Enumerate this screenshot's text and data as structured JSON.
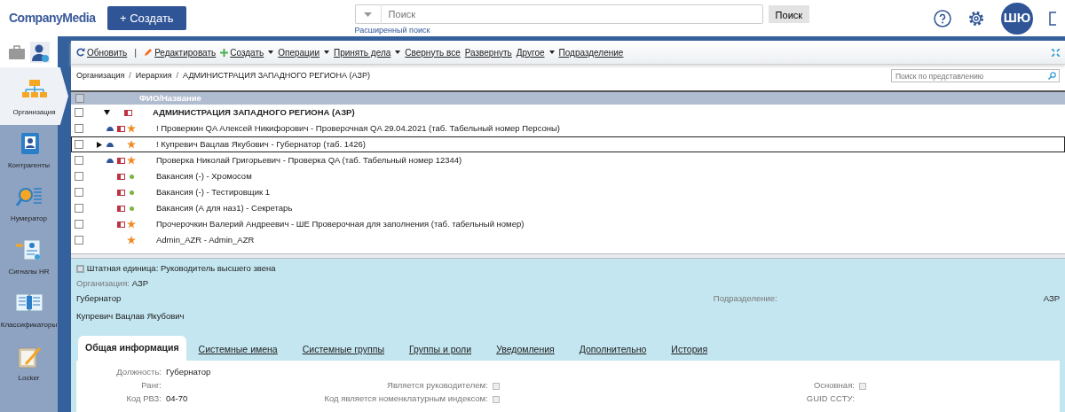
{
  "header": {
    "logo": "CompanyMedia",
    "create_button": "+ Создать",
    "search": {
      "placeholder": "Поиск",
      "button": "Поиск",
      "advanced_link": "Расширенный поиск"
    },
    "avatar": "ШЮ"
  },
  "sidebar": {
    "items": [
      {
        "label": "Организация",
        "selected": true
      },
      {
        "label": "Контрагенты",
        "selected": false
      },
      {
        "label": "Нумератор",
        "selected": false
      },
      {
        "label": "Сигналы HR",
        "selected": false
      },
      {
        "label": "Классификаторы",
        "selected": false
      },
      {
        "label": "Locker",
        "selected": false
      }
    ]
  },
  "toolbar": [
    {
      "kind": "button",
      "label": "Обновить",
      "menu": false
    },
    {
      "kind": "separator",
      "label": "|"
    },
    {
      "kind": "button",
      "label": "Редактировать",
      "menu": false
    },
    {
      "kind": "button",
      "label": "Создать",
      "menu": true
    },
    {
      "kind": "button",
      "label": "Операции",
      "menu": true
    },
    {
      "kind": "button",
      "label": "Принять дела",
      "menu": true
    },
    {
      "kind": "button",
      "label": "Свернуть все",
      "menu": false
    },
    {
      "kind": "button",
      "label": "Развернуть",
      "menu": false
    },
    {
      "kind": "button",
      "label": "Другое",
      "menu": true
    },
    {
      "kind": "button",
      "label": "Подразделение",
      "menu": false
    }
  ],
  "breadcrumb": [
    {
      "kind": "text",
      "label": "Организация"
    },
    {
      "kind": "separator",
      "label": "/"
    },
    {
      "kind": "link",
      "label": "Иерархия"
    },
    {
      "kind": "separator",
      "label": "/"
    },
    {
      "kind": "link",
      "label": "АДМИНИСТРАЦИЯ ЗАПАДНОГО РЕГИОНА (АЗР)"
    }
  ],
  "view_search": {
    "placeholder": "Поиск по представлению"
  },
  "table": {
    "select_all_checked": false,
    "columns": [
      "ФИО/Название"
    ],
    "rows": [
      {
        "kind": "unit",
        "text": "АДМИНИСТРАЦИЯ ЗАПАДНОГО РЕГИОНА (АЗР)",
        "expanded": true,
        "person": false,
        "card": true,
        "selected": false,
        "checked": false
      },
      {
        "kind": "employee",
        "text": "! Проверкин QA Алексей Никифорович - Проверочная QA 29.04.2021 (таб. Табельный номер Персоны)",
        "person": true,
        "card": true,
        "selected": false,
        "checked": false
      },
      {
        "kind": "employee",
        "text": "! Купревич Вацлав Якубович - Губернатор (таб. 1426)",
        "expanded": false,
        "person": true,
        "card": false,
        "selected": true,
        "checked": false
      },
      {
        "kind": "employee",
        "text": "Проверка Николай Григорьевич - Проверка QA (таб. Табельный номер 12344)",
        "person": true,
        "card": true,
        "selected": false,
        "checked": false
      },
      {
        "kind": "vacancy",
        "text": "Вакансия (-) - Хромосом",
        "person": false,
        "card": true,
        "selected": false,
        "checked": false
      },
      {
        "kind": "vacancy",
        "text": "Вакансия (-) - Тестировщик 1",
        "person": false,
        "card": true,
        "selected": false,
        "checked": false
      },
      {
        "kind": "vacancy",
        "text": "Вакансия (А для наз1) - Секретарь",
        "person": false,
        "card": true,
        "selected": false,
        "checked": false
      },
      {
        "kind": "employee",
        "text": "Прочерочкин Валерий Андреевич - ШЕ Проверочная для заполнения (таб. табельный номер)",
        "person": false,
        "card": true,
        "selected": false,
        "checked": false
      },
      {
        "kind": "employee",
        "text": "Admin_AZR - Admin_AZR",
        "person": false,
        "card": false,
        "selected": false,
        "checked": false
      }
    ]
  },
  "detail": {
    "title": "Штатная единица: Руководитель высшего звена",
    "org_label": "Организация:",
    "org_value": "АЗР",
    "position": "Губернатор",
    "person": "Купревич Вацлав Якубович",
    "unit_label": "Подразделение:",
    "unit_value": "АЗР",
    "tabs": [
      {
        "label": "Общая информация",
        "selected": true
      },
      {
        "label": "Системные имена",
        "selected": false
      },
      {
        "label": "Системные группы",
        "selected": false
      },
      {
        "label": "Группы и роли",
        "selected": false
      },
      {
        "label": "Уведомления",
        "selected": false
      },
      {
        "label": "Дополнительно",
        "selected": false
      },
      {
        "label": "История",
        "selected": false
      }
    ],
    "fields_left": [
      {
        "kind": "text",
        "label": "Должность:",
        "value": "Губернатор"
      },
      {
        "kind": "text",
        "label": "Ранг:"
      },
      {
        "kind": "text",
        "label": "Код РВЗ:",
        "value": "04-70"
      }
    ],
    "fields_mid": [
      {
        "kind": "checkbox",
        "label": "Является руководителем:",
        "checked": false
      },
      {
        "kind": "checkbox",
        "label": "Код является номенклатурным индексом:",
        "checked": false
      }
    ],
    "fields_right": [
      {
        "kind": "checkbox",
        "label": "Основная:",
        "checked": false
      },
      {
        "kind": "text",
        "label": "GUID ССТУ:"
      }
    ]
  }
}
